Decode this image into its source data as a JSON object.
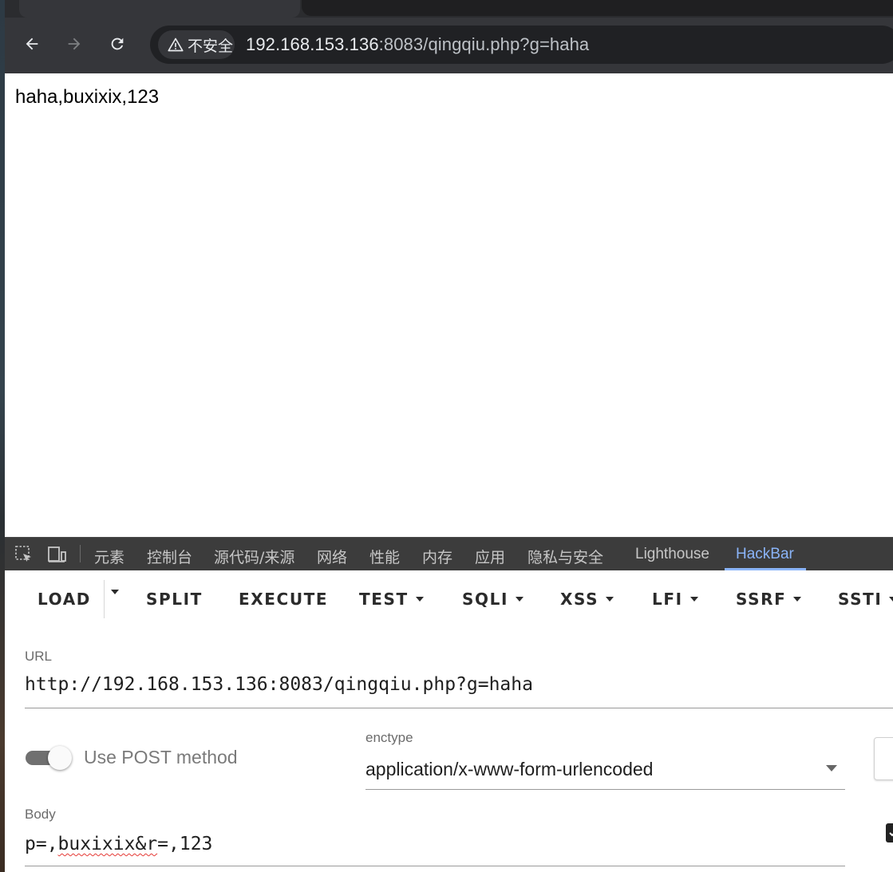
{
  "browser": {
    "security_label": "不安全",
    "url_host": "192.168.153.136",
    "url_rest": ":8083/qingqiu.php?g=haha"
  },
  "page": {
    "output": "haha,buxixix,123"
  },
  "devtools": {
    "tabs": [
      "元素",
      "控制台",
      "源代码/来源",
      "网络",
      "性能",
      "内存",
      "应用",
      "隐私与安全",
      "Lighthouse",
      "HackBar"
    ],
    "active_tab": "HackBar"
  },
  "hackbar": {
    "buttons": {
      "load": "LOAD",
      "split": "SPLIT",
      "execute": "EXECUTE",
      "test": "TEST",
      "sqli": "SQLI",
      "xss": "XSS",
      "lfi": "LFI",
      "ssrf": "SSRF",
      "ssti": "SSTI"
    },
    "url_label": "URL",
    "url_value": "http://192.168.153.136:8083/qingqiu.php?g=haha",
    "post_toggle_label": "Use POST method",
    "post_enabled": true,
    "enctype_label": "enctype",
    "enctype_value": "application/x-www-form-urlencoded",
    "body_label": "Body",
    "body_prefix": "p=,",
    "body_misspelled": "buxixix&r",
    "body_suffix": "=,123"
  },
  "colors": {
    "active_tab_accent": "#8ab4f8",
    "chrome_dark": "#35363a"
  }
}
